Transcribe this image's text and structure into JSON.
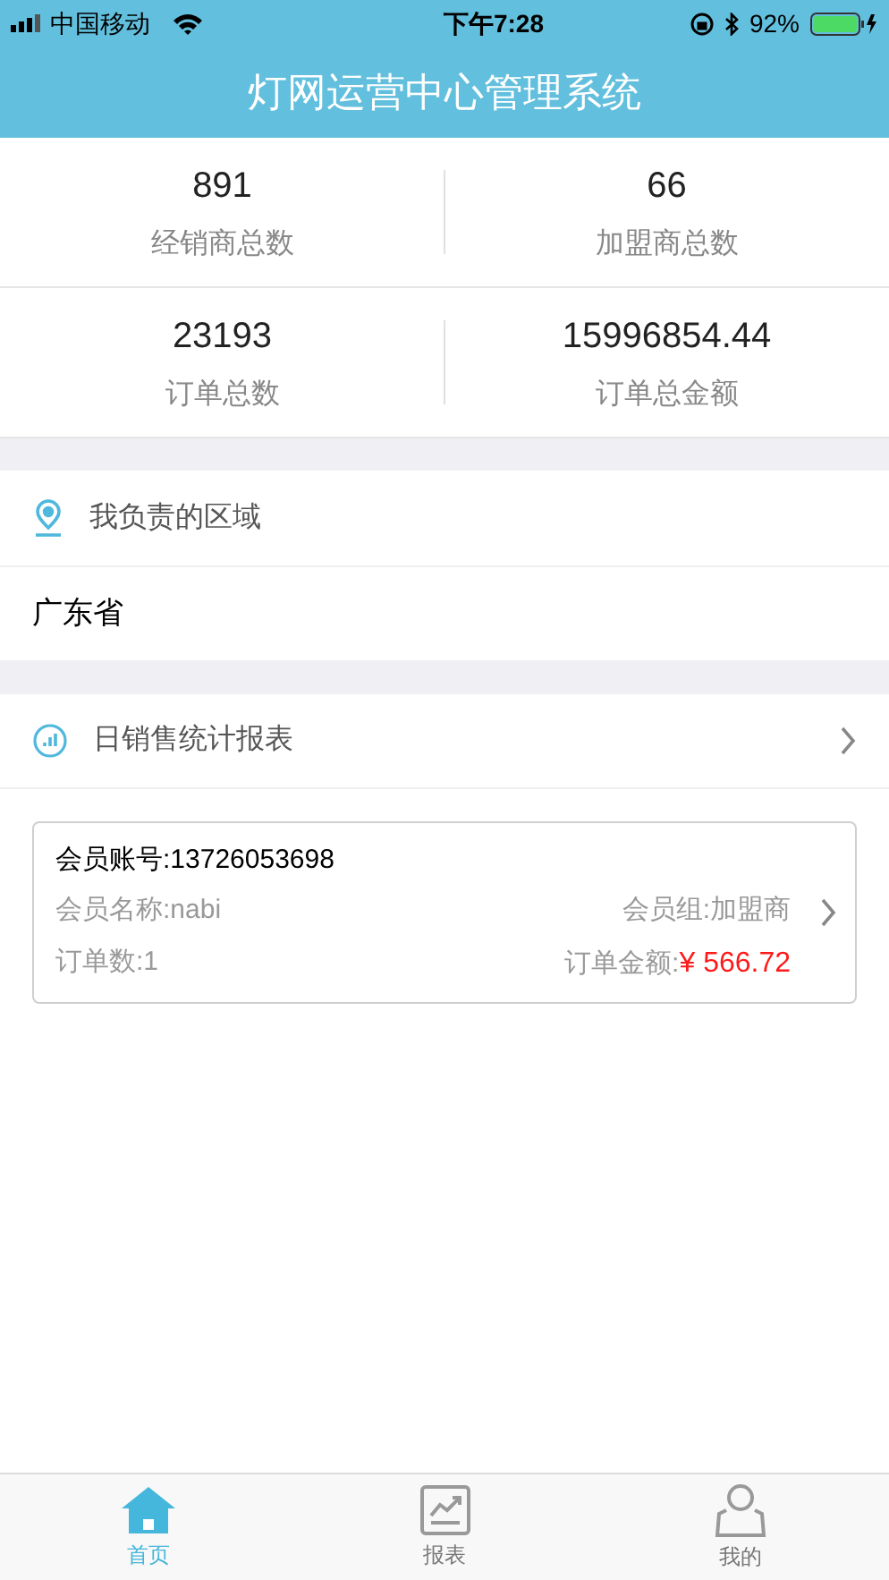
{
  "status_bar": {
    "carrier": "中国移动",
    "time": "下午7:28",
    "battery": "92%"
  },
  "header": {
    "title": "灯网运营中心管理系统"
  },
  "stats": [
    {
      "value": "891",
      "label": "经销商总数"
    },
    {
      "value": "66",
      "label": "加盟商总数"
    },
    {
      "value": "23193",
      "label": "订单总数"
    },
    {
      "value": "15996854.44",
      "label": "订单总金额"
    }
  ],
  "region": {
    "title": "我负责的区域",
    "value": "广东省"
  },
  "report": {
    "title": "日销售统计报表"
  },
  "members": [
    {
      "account": "会员账号:13726053698",
      "name": "会员名称:nabi",
      "group": "会员组:加盟商",
      "orders": "订单数:1",
      "amount_label": "订单金额:",
      "amount": "¥ 566.72"
    }
  ],
  "tabs": [
    {
      "label": "首页",
      "kind": "home",
      "selected": true
    },
    {
      "label": "报表",
      "kind": "chart",
      "selected": false
    },
    {
      "label": "我的",
      "kind": "user",
      "selected": false
    }
  ]
}
